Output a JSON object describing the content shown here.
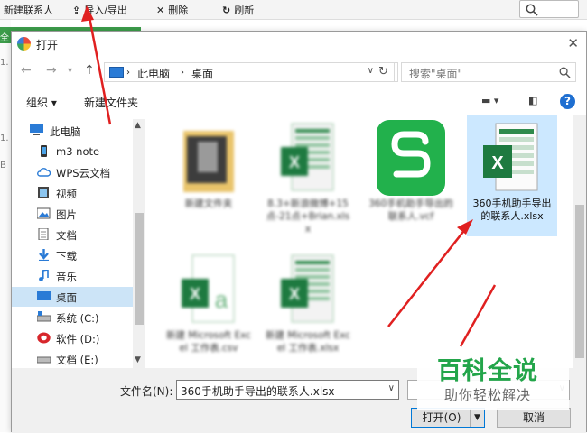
{
  "app_toolbar": {
    "new_contact": "新建联系人",
    "import_export": "导入/导出",
    "delete": "删除",
    "refresh": "刷新",
    "side_fragments": [
      "全",
      "1.",
      "1.",
      "B"
    ]
  },
  "dialog": {
    "title": "打开",
    "breadcrumb": [
      "此电脑",
      "桌面"
    ],
    "search_placeholder": "搜索\"桌面\"",
    "organize": "组织 ▾",
    "new_folder": "新建文件夹",
    "nav_items": [
      {
        "label": "此电脑",
        "icon": "computer-icon"
      },
      {
        "label": "m3 note",
        "icon": "phone-icon"
      },
      {
        "label": "WPS云文档",
        "icon": "cloud-icon"
      },
      {
        "label": "视频",
        "icon": "video-icon"
      },
      {
        "label": "图片",
        "icon": "picture-icon"
      },
      {
        "label": "文档",
        "icon": "document-icon"
      },
      {
        "label": "下载",
        "icon": "download-icon"
      },
      {
        "label": "音乐",
        "icon": "music-icon"
      },
      {
        "label": "桌面",
        "icon": "desktop-icon",
        "selected": true
      },
      {
        "label": "系统 (C:)",
        "icon": "drive-icon"
      },
      {
        "label": "软件 (D:)",
        "icon": "drive-icon"
      },
      {
        "label": "文档 (E:)",
        "icon": "drive-icon"
      }
    ],
    "files": [
      {
        "label": "新建文件夹",
        "type": "folder"
      },
      {
        "label": "8.3+新浪微博+15点-21点+Brian.xlsx",
        "type": "xlsx"
      },
      {
        "label": "360手机助手导出的联系人.vcf",
        "type": "wps"
      },
      {
        "label": "360手机助手导出的联系人.xlsx",
        "type": "xlsx",
        "selected": true
      },
      {
        "label": "新建 Microsoft Excel 工作表.csv",
        "type": "csv"
      },
      {
        "label": "新建 Microsoft Excel 工作表.xlsx",
        "type": "xlsx"
      }
    ],
    "filename_label": "文件名(N):",
    "filename_value": "360手机助手导出的联系人.xlsx",
    "open_button": "打开(O)",
    "cancel_button": "取消"
  },
  "watermark": {
    "title": "百科全说",
    "subtitle": "助你轻松解决"
  },
  "colors": {
    "accent_green": "#23a54a",
    "selection": "#cce8ff",
    "arrow_red": "#e02020"
  }
}
